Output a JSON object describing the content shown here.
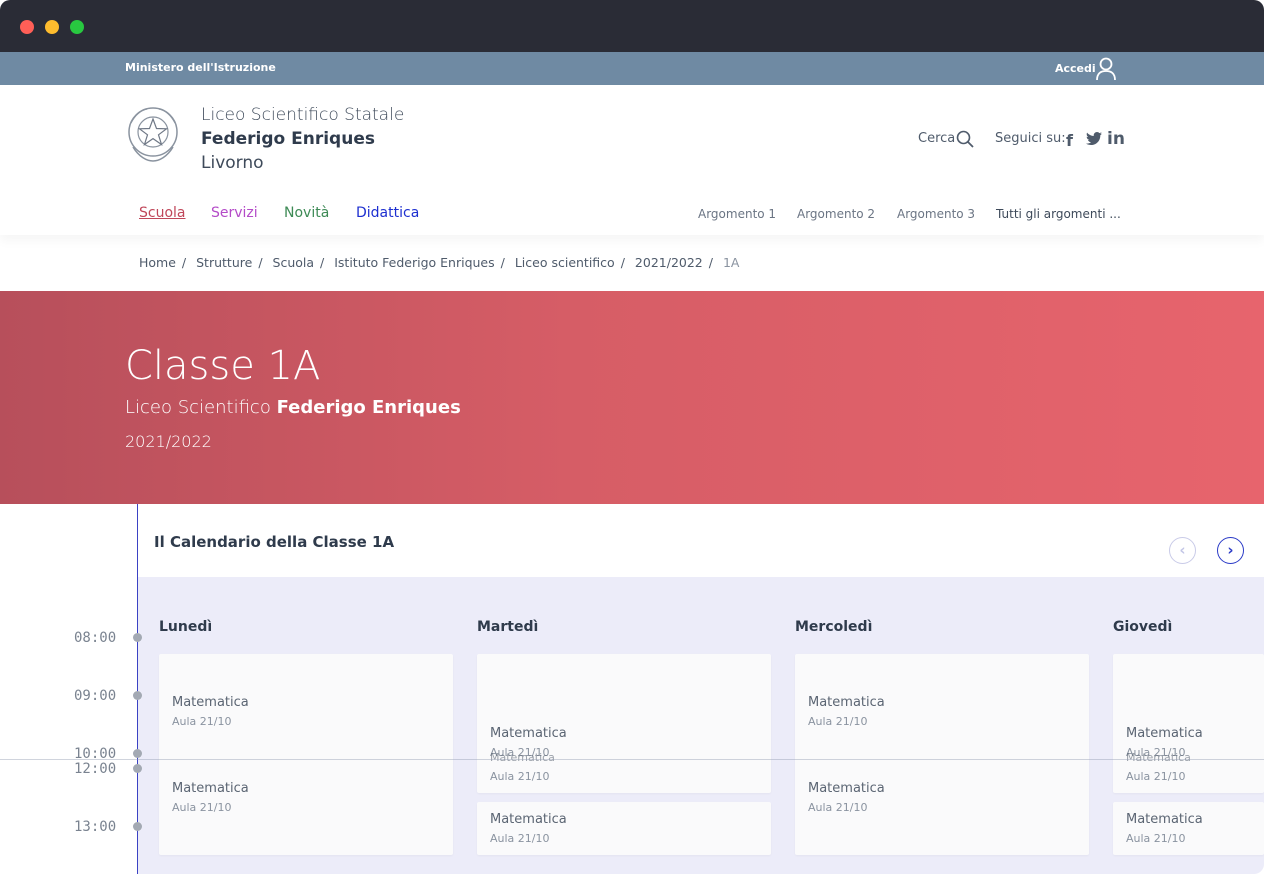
{
  "topbar": {
    "ministry": "Ministero dell'Istruzione",
    "login": "Accedi"
  },
  "header": {
    "school_line1": "Liceo Scientifico Statale",
    "school_line2": "Federigo Enriques",
    "school_line3": "Livorno",
    "search": "Cerca",
    "follow": "Seguici su:"
  },
  "nav": {
    "items": [
      {
        "label": "Scuola",
        "color": "#c0475a"
      },
      {
        "label": "Servizi",
        "color": "#b44bc8"
      },
      {
        "label": "Novità",
        "color": "#3d8a55"
      },
      {
        "label": "Didattica",
        "color": "#1d2fd0"
      }
    ],
    "topics": [
      "Argomento 1",
      "Argomento 2",
      "Argomento 3",
      "Tutti gli argomenti ..."
    ]
  },
  "breadcrumb": [
    "Home",
    "Strutture",
    "Scuola",
    "Istituto Federigo Enriques",
    "Liceo scientifico",
    "2021/2022",
    "1A"
  ],
  "hero": {
    "title": "Classe 1A",
    "subtitle_plain": "Liceo Scientifico ",
    "subtitle_bold": "Federigo Enriques",
    "year": "2021/2022"
  },
  "calendar": {
    "title": "Il Calendario della Classe 1A",
    "days": [
      "Lunedì",
      "Martedì",
      "Mercoledì",
      "Giovedì"
    ],
    "times": [
      "08:00",
      "09:00",
      "10:00",
      "12:00",
      "13:00"
    ],
    "lesson": {
      "subject": "Matematica",
      "room": "Aula 21/10"
    }
  },
  "colors": {
    "accent": "#2b3bc7",
    "hero_start": "#b74f5b",
    "hero_end": "#e7646d",
    "topbar": "#6f8aa3"
  }
}
